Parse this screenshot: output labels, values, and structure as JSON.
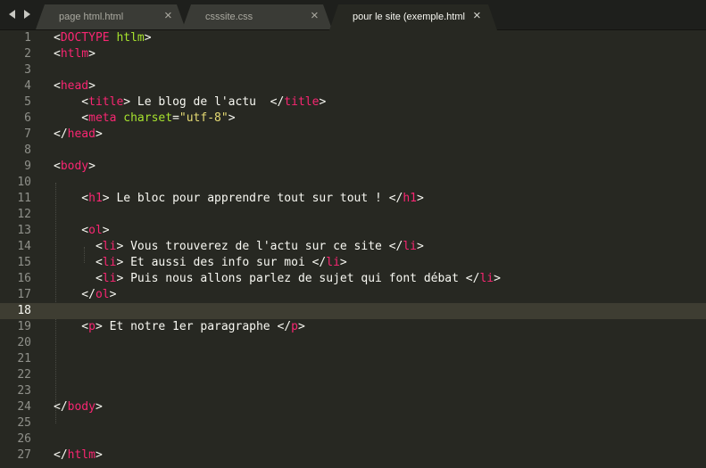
{
  "tabs": [
    {
      "label": "page html.html",
      "close": "×",
      "active": false
    },
    {
      "label": "csssite.css",
      "close": "×",
      "active": false
    },
    {
      "label": "pour le site (exemple.html",
      "close": "×",
      "active": true
    }
  ],
  "editor": {
    "current_line": 18,
    "lines": [
      [
        [
          "p",
          "<"
        ],
        [
          "t",
          "DOCTYPE"
        ],
        [
          "p",
          " "
        ],
        [
          "a",
          "htlm"
        ],
        [
          "p",
          ">"
        ]
      ],
      [
        [
          "p",
          "<"
        ],
        [
          "t",
          "htlm"
        ],
        [
          "p",
          ">"
        ]
      ],
      [],
      [
        [
          "p",
          "<"
        ],
        [
          "t",
          "head"
        ],
        [
          "p",
          ">"
        ]
      ],
      [
        [
          "p",
          "    <"
        ],
        [
          "t",
          "title"
        ],
        [
          "p",
          "> Le blog de l'actu  </"
        ],
        [
          "t",
          "title"
        ],
        [
          "p",
          ">"
        ]
      ],
      [
        [
          "p",
          "    <"
        ],
        [
          "t",
          "meta"
        ],
        [
          "p",
          " "
        ],
        [
          "a",
          "charset"
        ],
        [
          "p",
          "="
        ],
        [
          "s",
          "\"utf-8\""
        ],
        [
          "p",
          ">"
        ]
      ],
      [
        [
          "p",
          "</"
        ],
        [
          "t",
          "head"
        ],
        [
          "p",
          ">"
        ]
      ],
      [],
      [
        [
          "p",
          "<"
        ],
        [
          "t",
          "body"
        ],
        [
          "p",
          ">"
        ]
      ],
      [],
      [
        [
          "p",
          "    <"
        ],
        [
          "t",
          "h1"
        ],
        [
          "p",
          "> Le bloc pour apprendre tout sur tout ! </"
        ],
        [
          "t",
          "h1"
        ],
        [
          "p",
          ">"
        ]
      ],
      [],
      [
        [
          "p",
          "    <"
        ],
        [
          "t",
          "ol"
        ],
        [
          "p",
          ">"
        ]
      ],
      [
        [
          "p",
          "      <"
        ],
        [
          "t",
          "li"
        ],
        [
          "p",
          "> Vous trouverez de l'actu sur ce site </"
        ],
        [
          "t",
          "li"
        ],
        [
          "p",
          ">"
        ]
      ],
      [
        [
          "p",
          "      <"
        ],
        [
          "t",
          "li"
        ],
        [
          "p",
          "> Et aussi des info sur moi </"
        ],
        [
          "t",
          "li"
        ],
        [
          "p",
          ">"
        ]
      ],
      [
        [
          "p",
          "      <"
        ],
        [
          "t",
          "li"
        ],
        [
          "p",
          "> Puis nous allons parlez de sujet qui font débat </"
        ],
        [
          "t",
          "li"
        ],
        [
          "p",
          ">"
        ]
      ],
      [
        [
          "p",
          "    </"
        ],
        [
          "t",
          "ol"
        ],
        [
          "p",
          ">"
        ]
      ],
      [],
      [
        [
          "p",
          "    <"
        ],
        [
          "t",
          "p"
        ],
        [
          "p",
          "> Et notre 1er paragraphe </"
        ],
        [
          "t",
          "p"
        ],
        [
          "p",
          ">"
        ]
      ],
      [],
      [],
      [],
      [],
      [
        [
          "p",
          "</"
        ],
        [
          "t",
          "body"
        ],
        [
          "p",
          ">"
        ]
      ],
      [],
      [],
      [
        [
          "p",
          "</"
        ],
        [
          "t",
          "htlm"
        ],
        [
          "p",
          ">"
        ]
      ]
    ]
  },
  "colors": {
    "background": "#272822",
    "tag": "#f92672",
    "attribute": "#a6e22e",
    "string": "#e6db74",
    "text": "#f8f8f2",
    "gutter": "#8f908a",
    "current_line": "#3e3d32"
  }
}
